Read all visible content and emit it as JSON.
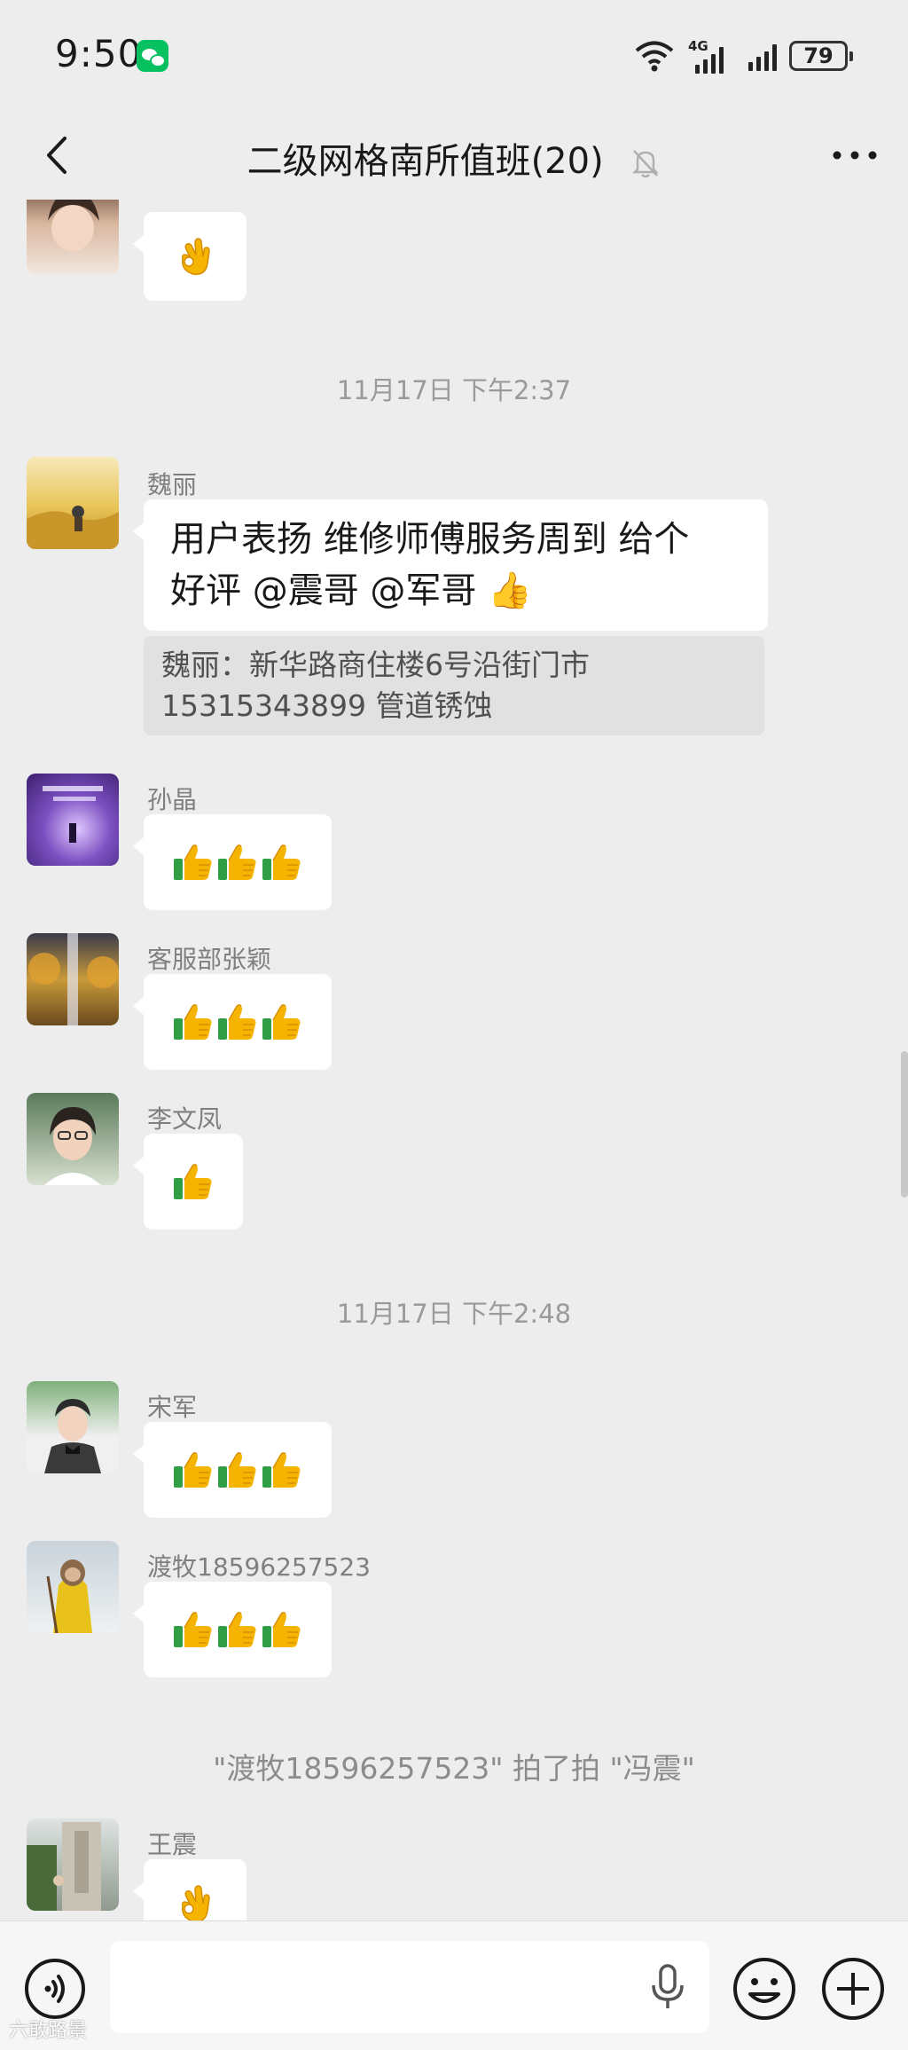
{
  "status_bar": {
    "time": "9:50",
    "network": "4G",
    "battery": "79"
  },
  "header": {
    "title": "二级网格南所值班(20)",
    "icons": [
      "back-icon",
      "mute-bell-icon",
      "more-icon"
    ]
  },
  "messages": [
    {
      "type": "message",
      "sender": "",
      "emoji": "👌"
    },
    {
      "type": "timestamp",
      "text": "11月17日 下午2:37"
    },
    {
      "type": "message",
      "sender": "魏丽",
      "text_line1": "用户表扬 维修师傅服务周到  给个",
      "text_line2": "好评  @震哥  @军哥 👍",
      "quote_line1": "魏丽：新华路商住楼6号沿街门市",
      "quote_line2": "15315343899 管道锈蚀"
    },
    {
      "type": "message",
      "sender": "孙晶",
      "emoji": "👍👍👍"
    },
    {
      "type": "message",
      "sender": "客服部张颖",
      "emoji": "👍👍👍"
    },
    {
      "type": "message",
      "sender": "李文凤",
      "emoji": "👍"
    },
    {
      "type": "timestamp",
      "text": "11月17日 下午2:48"
    },
    {
      "type": "message",
      "sender": "宋军",
      "emoji": "👍👍👍"
    },
    {
      "type": "message",
      "sender": "渡牧18596257523",
      "emoji": "👍👍👍"
    },
    {
      "type": "system",
      "text": "\"渡牧18596257523\" 拍了拍 \"冯震\""
    },
    {
      "type": "message",
      "sender": "王震",
      "emoji": "👌"
    }
  ],
  "input_bar": {
    "icons": [
      "voice-icon",
      "microphone-icon",
      "emoji-icon",
      "plus-icon"
    ]
  },
  "watermark": "六敢路景",
  "colors": {
    "background": "#ededed",
    "bubble": "#ffffff",
    "quote": "#e1e1e1",
    "wechat_green": "#07c160",
    "thumb_yellow": "#f4b400",
    "thumb_green": "#2f9e44"
  }
}
